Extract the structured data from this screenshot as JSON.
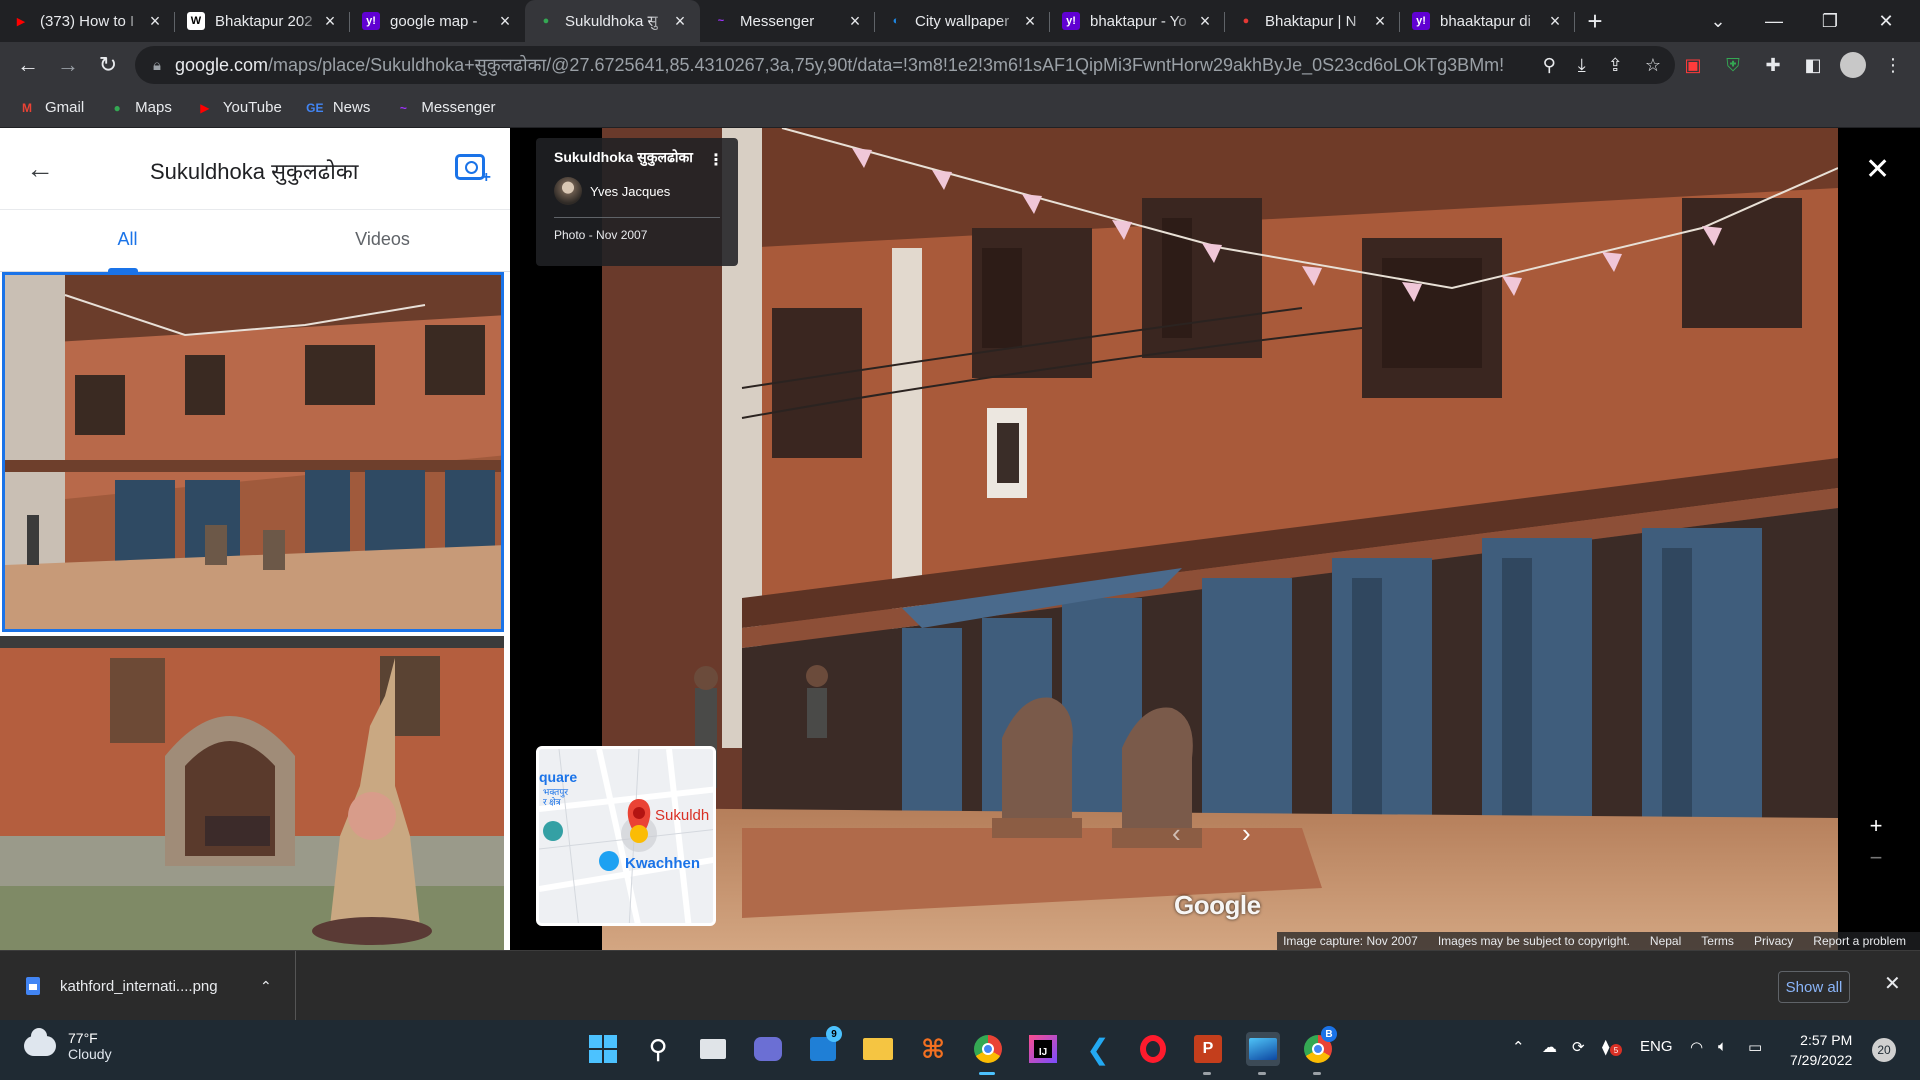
{
  "browser": {
    "tabs": [
      {
        "title": "(373) How to I",
        "icon": "youtube-icon",
        "color": "#ff0000",
        "glyph": "▶"
      },
      {
        "title": "Bhaktapur 202",
        "icon": "wikipedia-icon",
        "color": "#ffffff",
        "glyph": "W"
      },
      {
        "title": "google map -",
        "icon": "yahoo-icon",
        "color": "#6001d2",
        "glyph": "y!"
      },
      {
        "title": "Sukuldhoka सु",
        "icon": "google-maps-icon",
        "color": "#34a853",
        "glyph": "●"
      },
      {
        "title": "Messenger",
        "icon": "messenger-icon",
        "color": "#a033ff",
        "glyph": "~"
      },
      {
        "title": "City wallpaper",
        "icon": "wallpaper-site-icon",
        "color": "#1e88e5",
        "glyph": "◐"
      },
      {
        "title": "bhaktapur - Yo",
        "icon": "yahoo-icon",
        "color": "#6001d2",
        "glyph": "y!"
      },
      {
        "title": "Bhaktapur | N",
        "icon": "red-circle-icon",
        "color": "#e53935",
        "glyph": "●"
      },
      {
        "title": "bhaaktapur di",
        "icon": "yahoo-icon",
        "color": "#6001d2",
        "glyph": "y!"
      }
    ],
    "active_tab": 3,
    "url_host": "google.com",
    "url_path": "/maps/place/Sukuldhoka+सुकुलढोका/@27.6725641,85.4310267,3a,75y,90t/data=!3m8!1e2!3m6!1sAF1QipMi3FwntHorw29akhByJe_0S23cd6oLOkTg3BMm!2e1...",
    "bookmarks": [
      {
        "label": "Gmail",
        "icon": "gmail-icon",
        "color": "#ea4335",
        "glyph": "M"
      },
      {
        "label": "Maps",
        "icon": "maps-pin-icon",
        "color": "#34a853",
        "glyph": "●"
      },
      {
        "label": "YouTube",
        "icon": "youtube-icon",
        "color": "#ff0000",
        "glyph": "▶"
      },
      {
        "label": "News",
        "icon": "google-news-icon",
        "color": "#4285f4",
        "glyph": "GE"
      },
      {
        "label": "Messenger",
        "icon": "messenger-icon",
        "color": "#a033ff",
        "glyph": "~"
      }
    ]
  },
  "panel": {
    "title": "Sukuldhoka सुकुलढोका",
    "tabs": [
      "All",
      "Videos"
    ],
    "active_tab": 0
  },
  "viewer": {
    "place_name": "Sukuldhoka सुकुलढोका",
    "author": "Yves Jacques",
    "photo_date": "Photo - Nov 2007",
    "minimap": {
      "label_square": "quare",
      "label_devanagari": "भक्तपुर\nर क्षेत्र",
      "label_place": "Sukuldh",
      "label_kwachhen": "Kwachhen"
    },
    "watermark": "Google",
    "footer_links": [
      "Image capture: Nov 2007",
      "Images may be subject to copyright.",
      "Nepal",
      "Terms",
      "Privacy",
      "Report a problem"
    ]
  },
  "downloads": {
    "file": "kathford_internati....png",
    "show_all": "Show all"
  },
  "taskbar": {
    "temp": "77°F",
    "condition": "Cloudy",
    "chat_badge": "9",
    "language": "ENG",
    "time": "2:57 PM",
    "date": "7/29/2022",
    "notifications": "20",
    "chrome_badge": "B",
    "tray_badge": "5"
  }
}
